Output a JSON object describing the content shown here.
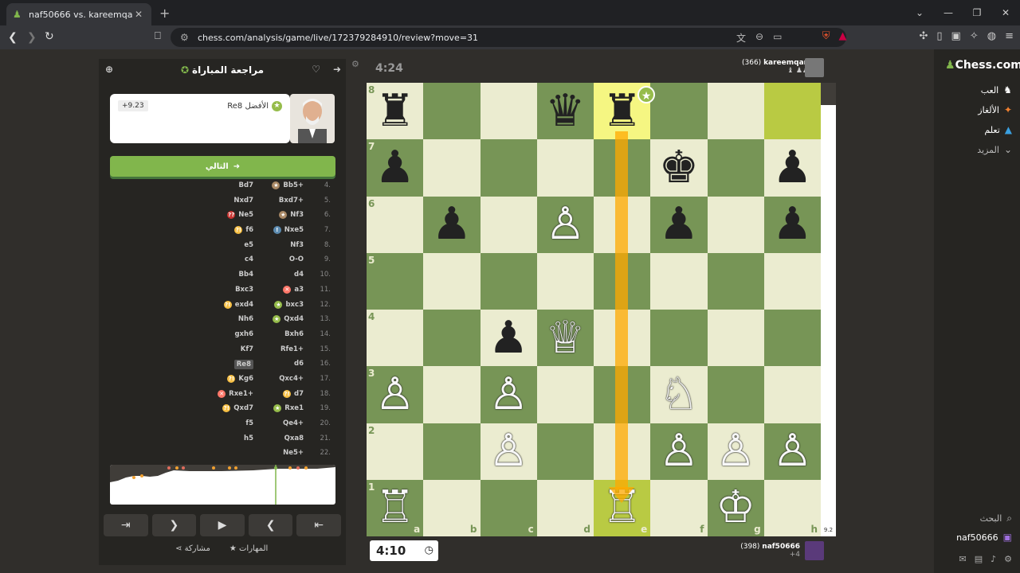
{
  "browser": {
    "tab_title": "naf50666 vs. kareemqandah | Analy",
    "url": "chess.com/analysis/game/live/172379284910/review?move=31"
  },
  "review": {
    "header": "مراجعة المباراة",
    "coach_best": "Re8 الأفضل",
    "coach_eval": "+9.23",
    "next_label": "التالي",
    "skills_label": "المهارات",
    "share_label": "مشاركة"
  },
  "moves": [
    {
      "num": "4.",
      "w": "Bb5+",
      "b": "Bd7",
      "wbadge": "book",
      "bbadge": ""
    },
    {
      "num": "5.",
      "w": "Bxd7+",
      "b": "Nxd7",
      "wbadge": "",
      "bbadge": ""
    },
    {
      "num": "6.",
      "w": "Nf3",
      "b": "Ne5",
      "wbadge": "book",
      "bbadge": "blunder"
    },
    {
      "num": "7.",
      "w": "Nxe5",
      "b": "f6",
      "wbadge": "great",
      "bbadge": "inacc"
    },
    {
      "num": "8.",
      "w": "Nf3",
      "b": "e5",
      "wbadge": "",
      "bbadge": ""
    },
    {
      "num": "9.",
      "w": "O-O",
      "b": "c4",
      "wbadge": "",
      "bbadge": ""
    },
    {
      "num": "10.",
      "w": "d4",
      "b": "Bb4",
      "wbadge": "",
      "bbadge": ""
    },
    {
      "num": "11.",
      "w": "a3",
      "b": "Bxc3",
      "wbadge": "miss",
      "bbadge": ""
    },
    {
      "num": "12.",
      "w": "bxc3",
      "b": "exd4",
      "wbadge": "best",
      "bbadge": "inacc"
    },
    {
      "num": "13.",
      "w": "Qxd4",
      "b": "Nh6",
      "wbadge": "best",
      "bbadge": ""
    },
    {
      "num": "14.",
      "w": "Bxh6",
      "b": "gxh6",
      "wbadge": "",
      "bbadge": ""
    },
    {
      "num": "15.",
      "w": "Rfe1+",
      "b": "Kf7",
      "wbadge": "",
      "bbadge": ""
    },
    {
      "num": "16.",
      "w": "d6",
      "b": "Re8",
      "wbadge": "",
      "bbadge": ""
    },
    {
      "num": "17.",
      "w": "Qxc4+",
      "b": "Kg6",
      "wbadge": "",
      "bbadge": "inacc"
    },
    {
      "num": "18.",
      "w": "d7",
      "b": "Rxe1+",
      "wbadge": "inacc",
      "bbadge": "miss"
    },
    {
      "num": "19.",
      "w": "Rxe1",
      "b": "Qxd7",
      "wbadge": "best",
      "bbadge": "inacc"
    },
    {
      "num": "20.",
      "w": "Qe4+",
      "b": "f5",
      "wbadge": "",
      "bbadge": ""
    },
    {
      "num": "21.",
      "w": "Qxa8",
      "b": "h5",
      "wbadge": "",
      "bbadge": ""
    },
    {
      "num": "22.",
      "w": "Ne5+",
      "b": "",
      "wbadge": "",
      "bbadge": ""
    }
  ],
  "players": {
    "top_name": "kareemqandah",
    "top_rating": "(366)",
    "top_timer": "4:24",
    "bottom_name": "naf50666",
    "bottom_rating": "(398)",
    "bottom_timer": "4:10",
    "bottom_extra": "+4"
  },
  "board": {
    "ranks": [
      "8",
      "7",
      "6",
      "5",
      "4",
      "3",
      "2",
      "1"
    ],
    "files": [
      "a",
      "b",
      "c",
      "d",
      "e",
      "f",
      "g",
      "h"
    ],
    "eval_label": "9.2",
    "squares": [
      [
        "♜",
        "",
        "",
        "♛",
        "♜",
        "",
        "",
        ""
      ],
      [
        "♟",
        "",
        "",
        "",
        "",
        "♚",
        "",
        "♟"
      ],
      [
        "",
        "♟",
        "",
        "♙",
        "",
        "♟",
        "",
        "♟"
      ],
      [
        "",
        "",
        "",
        "",
        "",
        "",
        "",
        ""
      ],
      [
        "",
        "",
        "♟",
        "♕",
        "",
        "",
        "",
        ""
      ],
      [
        "♙",
        "",
        "♙",
        "",
        "",
        "♘",
        "",
        ""
      ],
      [
        "",
        "",
        "♙",
        "",
        "",
        "♙",
        "♙",
        "♙"
      ],
      [
        "♖",
        "",
        "",
        "",
        "♖",
        "",
        "♔",
        ""
      ]
    ],
    "piece_colors": [
      [
        "b",
        "",
        "",
        "b",
        "b",
        "",
        "",
        ""
      ],
      [
        "b",
        "",
        "",
        "",
        "",
        "b",
        "",
        "b"
      ],
      [
        "",
        "b",
        "",
        "w",
        "",
        "b",
        "",
        "b"
      ],
      [
        "",
        "",
        "",
        "",
        "",
        "",
        "",
        ""
      ],
      [
        "",
        "",
        "b",
        "w",
        "",
        "",
        "",
        ""
      ],
      [
        "w",
        "",
        "w",
        "",
        "",
        "w",
        "",
        ""
      ],
      [
        "",
        "",
        "w",
        "",
        "",
        "w",
        "w",
        "w"
      ],
      [
        "w",
        "",
        "",
        "",
        "w",
        "",
        "w",
        ""
      ]
    ]
  },
  "sidebar": {
    "logo": "Chess.com",
    "items": [
      "العب",
      "الألغاز",
      "تعلم",
      "المزيد"
    ],
    "search": "البحث",
    "user": "naf50666"
  },
  "colors": {
    "accent": "#81b64c",
    "board_light": "#ebecd0",
    "board_dark": "#779556"
  }
}
